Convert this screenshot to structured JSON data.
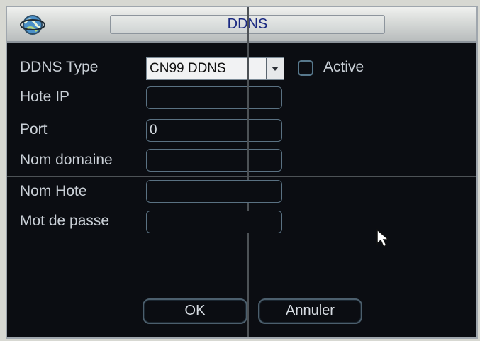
{
  "dialog": {
    "title": "DDNS"
  },
  "form": {
    "ddns_type_label": "DDNS Type",
    "ddns_type_value": "CN99 DDNS",
    "active_label": "Active",
    "host_ip_label": "Hote IP",
    "host_ip_value": "",
    "port_label": "Port",
    "port_value": "0",
    "domain_label": "Nom domaine",
    "domain_value": "",
    "host_name_label": "Nom Hote",
    "host_name_value": "",
    "password_label": "Mot de passe",
    "password_value": ""
  },
  "buttons": {
    "ok": "OK",
    "cancel": "Annuler"
  },
  "icons": {
    "title": "network-globe-icon",
    "dropdown": "chevron-down-icon",
    "cursor": "mouse-pointer-icon"
  }
}
